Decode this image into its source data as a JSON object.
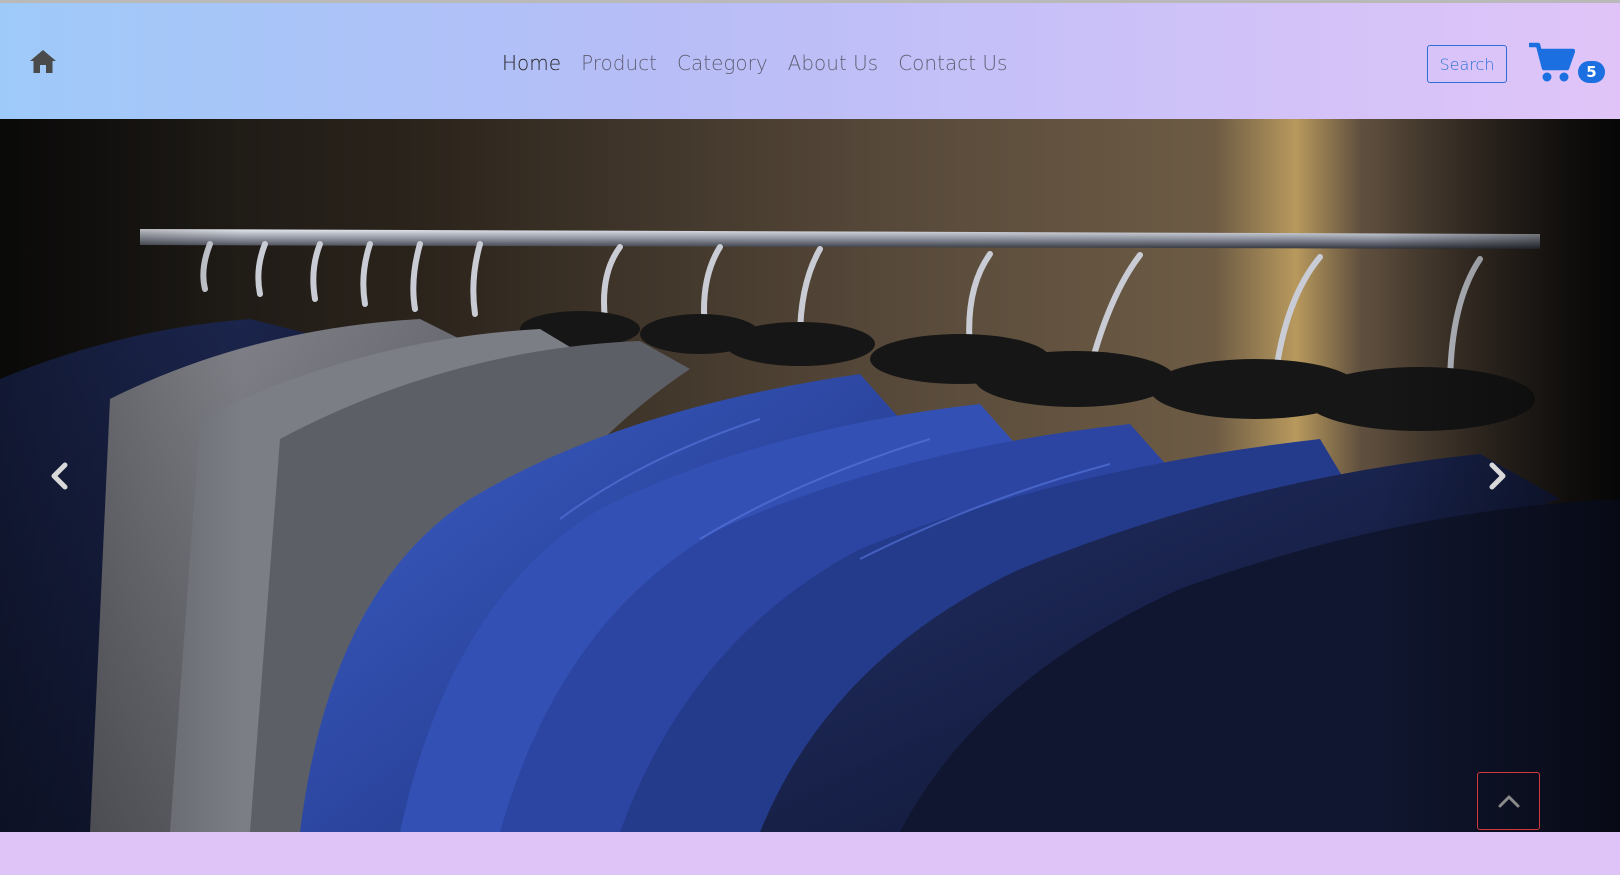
{
  "nav": {
    "home_icon": "home-icon",
    "links": [
      "Home",
      "Product",
      "Category",
      "About Us",
      "Contact Us"
    ],
    "active_link": "Home",
    "search_label": "Search"
  },
  "cart": {
    "icon": "cart-icon",
    "count": "5"
  },
  "carousel": {
    "prev_icon": "chevron-left-icon",
    "next_icon": "chevron-right-icon"
  },
  "scroll_top_icon": "chevron-up-icon",
  "colors": {
    "nav_gradient_start": "#9ecaf9",
    "nav_gradient_end": "#e0c4f8",
    "search_border": "#2b6fd8",
    "cart_blue": "#1c6fe0",
    "scroll_top_border": "#d23a3a",
    "bottom_band": "#dfc4f8"
  }
}
